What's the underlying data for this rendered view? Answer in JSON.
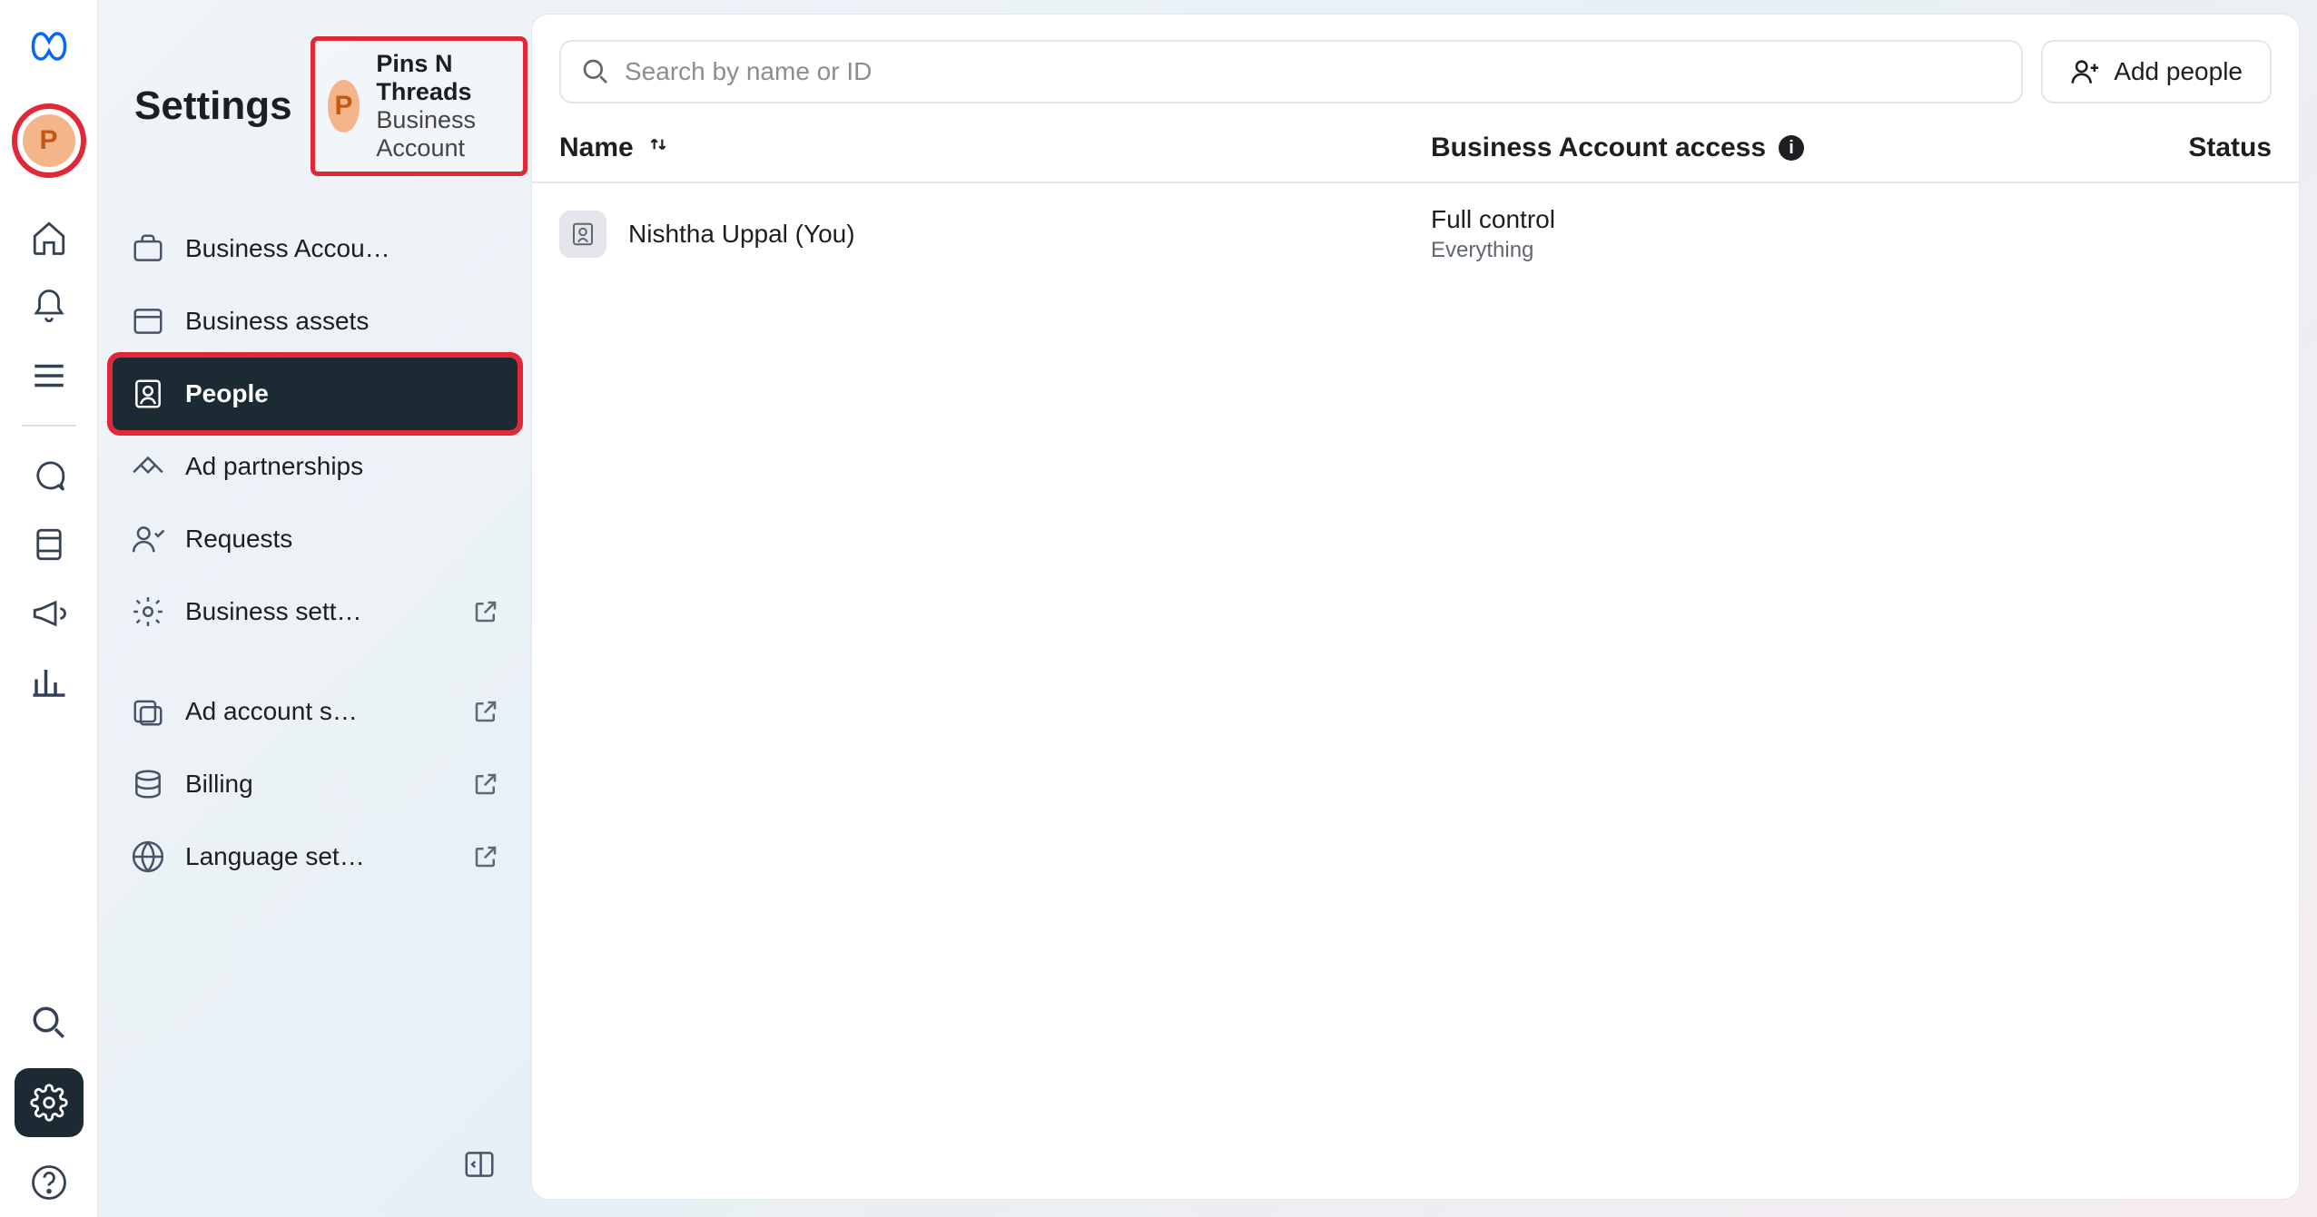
{
  "rail": {
    "account_initial": "P"
  },
  "sidebar": {
    "title": "Settings",
    "account": {
      "name": "Pins N Threads",
      "type": "Business Account",
      "initial": "P"
    },
    "items": [
      {
        "label": "Business Accou…"
      },
      {
        "label": "Business assets"
      },
      {
        "label": "People"
      },
      {
        "label": "Ad partnerships"
      },
      {
        "label": "Requests"
      },
      {
        "label": "Business sett…"
      },
      {
        "label": "Ad account s…"
      },
      {
        "label": "Billing"
      },
      {
        "label": "Language set…"
      }
    ]
  },
  "toolbar": {
    "search_placeholder": "Search by name or ID",
    "add_label": "Add people"
  },
  "columns": {
    "name": "Name",
    "access": "Business Account access",
    "status": "Status"
  },
  "rows": [
    {
      "name": "Nishtha Uppal (You)",
      "access": "Full control",
      "access_detail": "Everything",
      "status": ""
    }
  ]
}
